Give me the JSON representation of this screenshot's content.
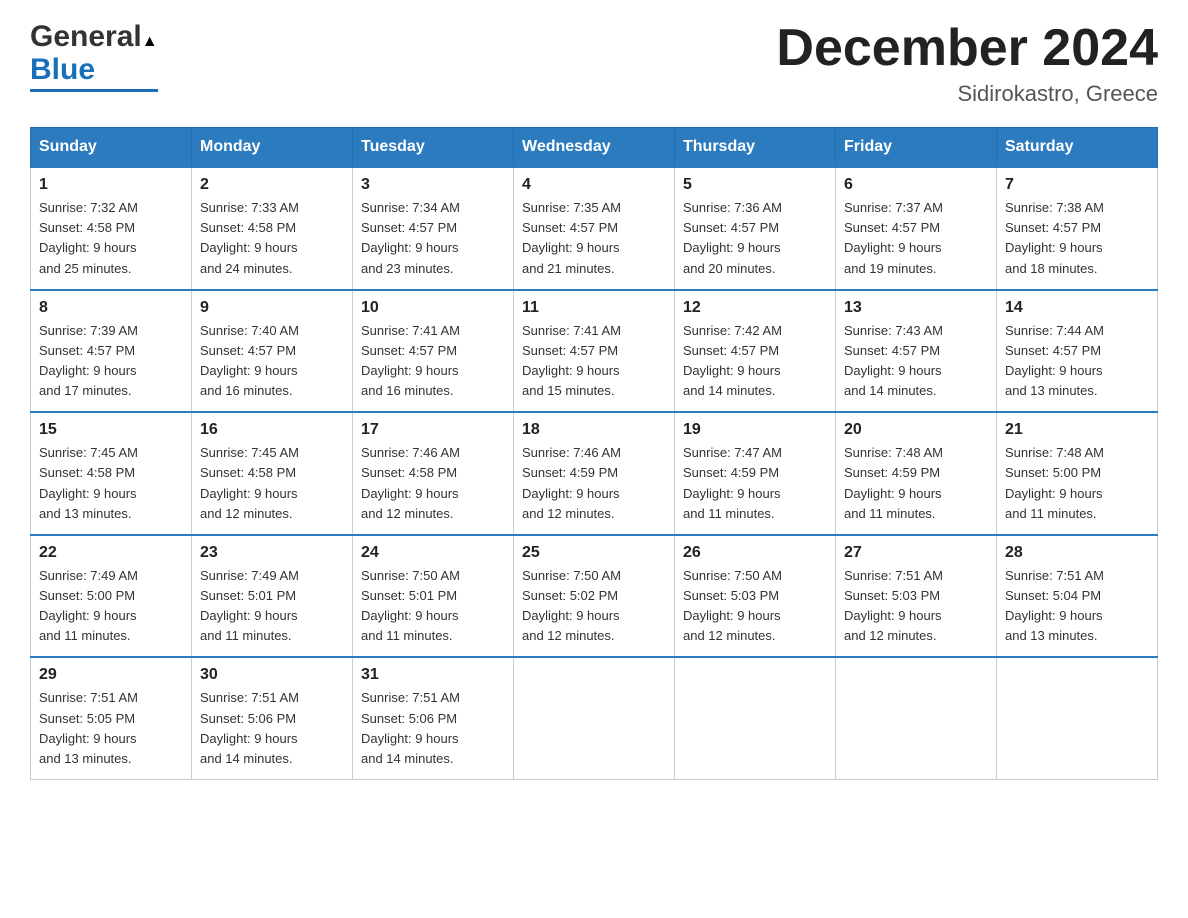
{
  "header": {
    "logo_general": "General",
    "logo_blue": "Blue",
    "month_title": "December 2024",
    "location": "Sidirokastro, Greece"
  },
  "days_of_week": [
    "Sunday",
    "Monday",
    "Tuesday",
    "Wednesday",
    "Thursday",
    "Friday",
    "Saturday"
  ],
  "weeks": [
    [
      {
        "day": "1",
        "sunrise": "7:32 AM",
        "sunset": "4:58 PM",
        "daylight": "9 hours and 25 minutes."
      },
      {
        "day": "2",
        "sunrise": "7:33 AM",
        "sunset": "4:58 PM",
        "daylight": "9 hours and 24 minutes."
      },
      {
        "day": "3",
        "sunrise": "7:34 AM",
        "sunset": "4:57 PM",
        "daylight": "9 hours and 23 minutes."
      },
      {
        "day": "4",
        "sunrise": "7:35 AM",
        "sunset": "4:57 PM",
        "daylight": "9 hours and 21 minutes."
      },
      {
        "day": "5",
        "sunrise": "7:36 AM",
        "sunset": "4:57 PM",
        "daylight": "9 hours and 20 minutes."
      },
      {
        "day": "6",
        "sunrise": "7:37 AM",
        "sunset": "4:57 PM",
        "daylight": "9 hours and 19 minutes."
      },
      {
        "day": "7",
        "sunrise": "7:38 AM",
        "sunset": "4:57 PM",
        "daylight": "9 hours and 18 minutes."
      }
    ],
    [
      {
        "day": "8",
        "sunrise": "7:39 AM",
        "sunset": "4:57 PM",
        "daylight": "9 hours and 17 minutes."
      },
      {
        "day": "9",
        "sunrise": "7:40 AM",
        "sunset": "4:57 PM",
        "daylight": "9 hours and 16 minutes."
      },
      {
        "day": "10",
        "sunrise": "7:41 AM",
        "sunset": "4:57 PM",
        "daylight": "9 hours and 16 minutes."
      },
      {
        "day": "11",
        "sunrise": "7:41 AM",
        "sunset": "4:57 PM",
        "daylight": "9 hours and 15 minutes."
      },
      {
        "day": "12",
        "sunrise": "7:42 AM",
        "sunset": "4:57 PM",
        "daylight": "9 hours and 14 minutes."
      },
      {
        "day": "13",
        "sunrise": "7:43 AM",
        "sunset": "4:57 PM",
        "daylight": "9 hours and 14 minutes."
      },
      {
        "day": "14",
        "sunrise": "7:44 AM",
        "sunset": "4:57 PM",
        "daylight": "9 hours and 13 minutes."
      }
    ],
    [
      {
        "day": "15",
        "sunrise": "7:45 AM",
        "sunset": "4:58 PM",
        "daylight": "9 hours and 13 minutes."
      },
      {
        "day": "16",
        "sunrise": "7:45 AM",
        "sunset": "4:58 PM",
        "daylight": "9 hours and 12 minutes."
      },
      {
        "day": "17",
        "sunrise": "7:46 AM",
        "sunset": "4:58 PM",
        "daylight": "9 hours and 12 minutes."
      },
      {
        "day": "18",
        "sunrise": "7:46 AM",
        "sunset": "4:59 PM",
        "daylight": "9 hours and 12 minutes."
      },
      {
        "day": "19",
        "sunrise": "7:47 AM",
        "sunset": "4:59 PM",
        "daylight": "9 hours and 11 minutes."
      },
      {
        "day": "20",
        "sunrise": "7:48 AM",
        "sunset": "4:59 PM",
        "daylight": "9 hours and 11 minutes."
      },
      {
        "day": "21",
        "sunrise": "7:48 AM",
        "sunset": "5:00 PM",
        "daylight": "9 hours and 11 minutes."
      }
    ],
    [
      {
        "day": "22",
        "sunrise": "7:49 AM",
        "sunset": "5:00 PM",
        "daylight": "9 hours and 11 minutes."
      },
      {
        "day": "23",
        "sunrise": "7:49 AM",
        "sunset": "5:01 PM",
        "daylight": "9 hours and 11 minutes."
      },
      {
        "day": "24",
        "sunrise": "7:50 AM",
        "sunset": "5:01 PM",
        "daylight": "9 hours and 11 minutes."
      },
      {
        "day": "25",
        "sunrise": "7:50 AM",
        "sunset": "5:02 PM",
        "daylight": "9 hours and 12 minutes."
      },
      {
        "day": "26",
        "sunrise": "7:50 AM",
        "sunset": "5:03 PM",
        "daylight": "9 hours and 12 minutes."
      },
      {
        "day": "27",
        "sunrise": "7:51 AM",
        "sunset": "5:03 PM",
        "daylight": "9 hours and 12 minutes."
      },
      {
        "day": "28",
        "sunrise": "7:51 AM",
        "sunset": "5:04 PM",
        "daylight": "9 hours and 13 minutes."
      }
    ],
    [
      {
        "day": "29",
        "sunrise": "7:51 AM",
        "sunset": "5:05 PM",
        "daylight": "9 hours and 13 minutes."
      },
      {
        "day": "30",
        "sunrise": "7:51 AM",
        "sunset": "5:06 PM",
        "daylight": "9 hours and 14 minutes."
      },
      {
        "day": "31",
        "sunrise": "7:51 AM",
        "sunset": "5:06 PM",
        "daylight": "9 hours and 14 minutes."
      },
      null,
      null,
      null,
      null
    ]
  ],
  "labels": {
    "sunrise": "Sunrise:",
    "sunset": "Sunset:",
    "daylight": "Daylight:"
  }
}
